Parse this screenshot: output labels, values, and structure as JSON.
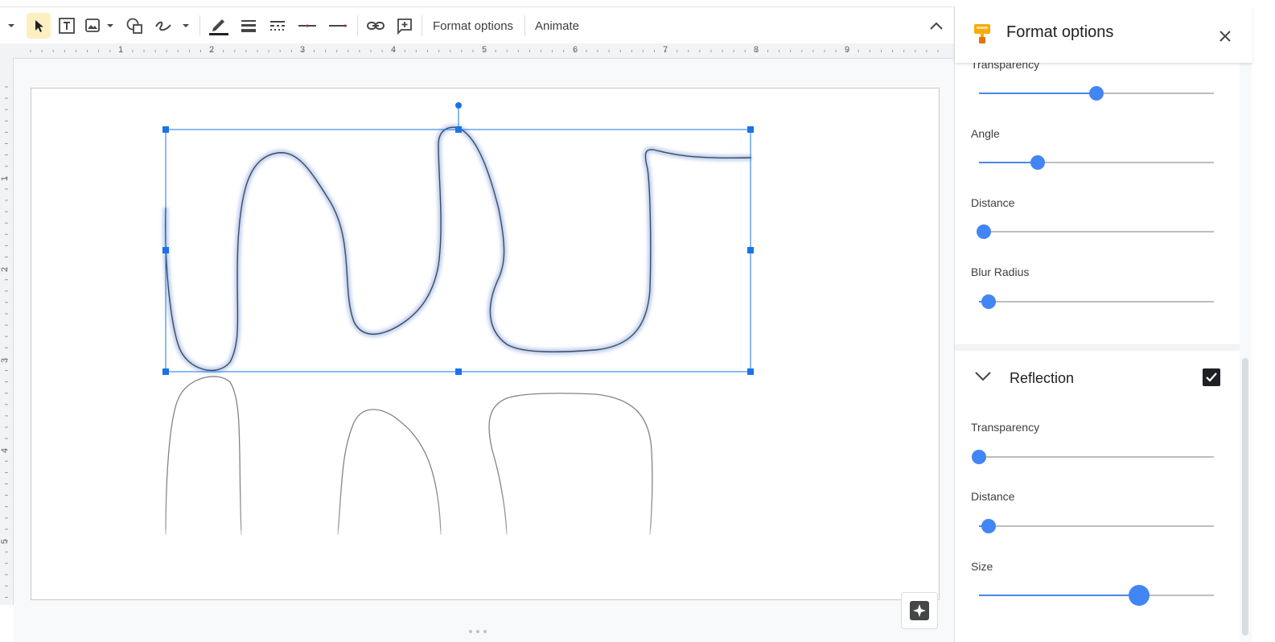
{
  "toolbar": {
    "format_options_label": "Format options",
    "animate_label": "Animate",
    "colors": {
      "active_bg": "#feefc3",
      "icon": "#444746"
    }
  },
  "ruler": {
    "top_numbers": [
      "1",
      "2",
      "3",
      "4",
      "5",
      "6",
      "7",
      "8",
      "9"
    ],
    "left_numbers": [
      "1",
      "2",
      "3",
      "4",
      "5"
    ]
  },
  "panel": {
    "title": "Format options",
    "drop_shadow": {
      "sliders": [
        {
          "label": "Transparency",
          "value": 0.5
        },
        {
          "label": "Angle",
          "value": 0.25
        },
        {
          "label": "Distance",
          "value": 0.02
        },
        {
          "label": "Blur Radius",
          "value": 0.04
        }
      ]
    },
    "reflection": {
      "title": "Reflection",
      "checked": true,
      "sliders": [
        {
          "label": "Transparency",
          "value": 0.0
        },
        {
          "label": "Distance",
          "value": 0.04
        },
        {
          "label": "Size",
          "value": 0.68
        }
      ]
    },
    "accent": "#4285f4"
  }
}
